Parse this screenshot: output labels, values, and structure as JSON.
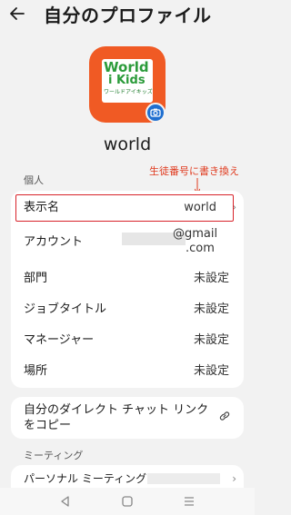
{
  "header": {
    "title": "自分のプロファイル"
  },
  "avatar": {
    "logo_line1": "World",
    "logo_line2": "i Kids",
    "logo_line3": "ワールドアイキッズ"
  },
  "profile": {
    "name": "world"
  },
  "annotation": {
    "text": "生徒番号に書き換え"
  },
  "section_personal": "個人",
  "rows": [
    {
      "label": "表示名",
      "value": "world"
    },
    {
      "label": "アカウント",
      "value_line1": "@gmail",
      "value_line2": ".com"
    },
    {
      "label": "部門",
      "value": "未設定"
    },
    {
      "label": "ジョブタイトル",
      "value": "未設定"
    },
    {
      "label": "マネージャー",
      "value": "未設定"
    },
    {
      "label": "場所",
      "value": "未設定"
    }
  ],
  "direct_link": {
    "label": "自分のダイレクト チャット リンクをコピー"
  },
  "section_meeting": "ミーティング",
  "meeting": {
    "label": "パーソナル ミーティング ."
  },
  "colors": {
    "accent": "#1f6fd0",
    "avatar_bg": "#f05a24",
    "highlight": "#d8232a",
    "annotation": "#e03a1e"
  }
}
